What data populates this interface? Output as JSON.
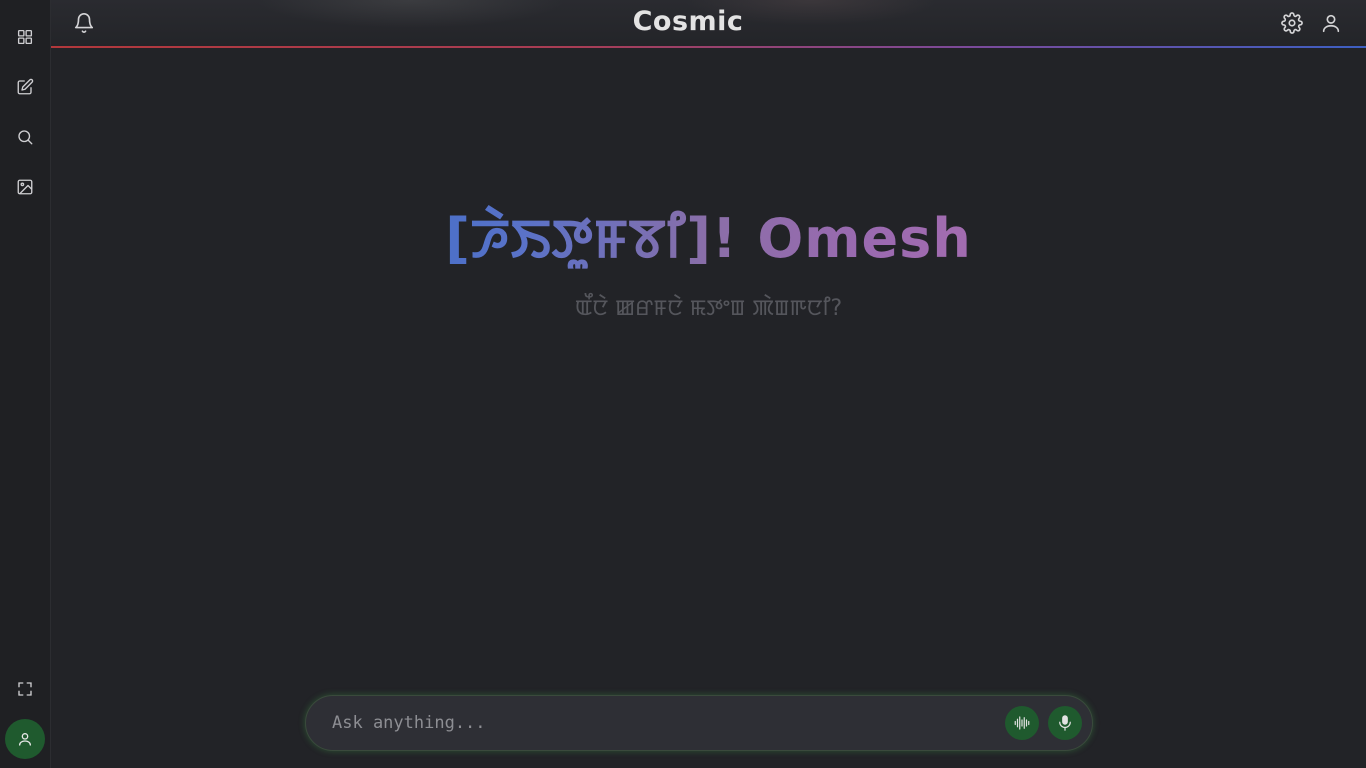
{
  "app": {
    "title": "Cosmic"
  },
  "sidebar": {
    "items": [
      {
        "icon": "grid-icon",
        "name": "apps"
      },
      {
        "icon": "edit-icon",
        "name": "new-chat"
      },
      {
        "icon": "search-icon",
        "name": "search"
      },
      {
        "icon": "image-icon",
        "name": "images"
      }
    ],
    "bottom": [
      {
        "icon": "fullscreen-icon",
        "name": "fullscreen"
      },
      {
        "icon": "user-icon",
        "name": "profile"
      }
    ]
  },
  "header": {
    "left_icon": "bell-icon",
    "right_icons": [
      "gear-icon",
      "user-icon"
    ]
  },
  "main": {
    "greeting": "[ꯍꯥꯏꯇꯨꯝꯕꯤ]! Omesh",
    "subtitle": "ꯑꯩꯅꯥ ꯀꯔꯝꯅꯥ ꯃꯇꯦꯡ ꯄꯥꯡꯒꯅꯤ?"
  },
  "composer": {
    "placeholder": "Ask anything...",
    "value": "",
    "voice_button_icon": "waveform-icon",
    "mic_button_icon": "microphone-icon"
  },
  "colors": {
    "background": "#222327",
    "sidebar": "#1f2023",
    "accent_green": "#1f5a2e",
    "header_line_start": "#b2383b",
    "header_line_end": "#3d5fc2"
  }
}
